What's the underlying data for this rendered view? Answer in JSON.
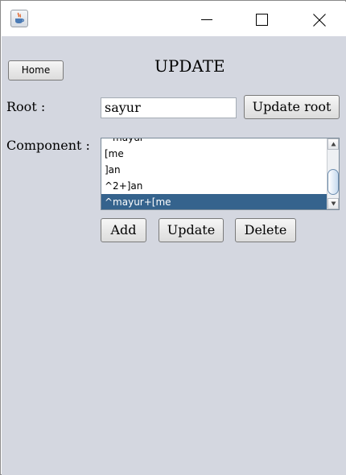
{
  "window": {
    "close_icon": "close-icon",
    "minimize_icon": "minimize-icon",
    "maximize_icon": "maximize-icon",
    "app_icon": "java-icon"
  },
  "header": {
    "home_label": "Home",
    "title": "UPDATE"
  },
  "root": {
    "label": "Root :",
    "value": "sayur",
    "button_label": "Update root"
  },
  "component": {
    "label": "Component :",
    "items": [
      "^mayur",
      "[me",
      "]an",
      "^2+]an",
      "^mayur+[me"
    ],
    "selected_index": 4
  },
  "actions": {
    "add_label": "Add",
    "update_label": "Update",
    "delete_label": "Delete"
  },
  "colors": {
    "content_background": "#d4d7e0",
    "selection": "#35638d"
  }
}
